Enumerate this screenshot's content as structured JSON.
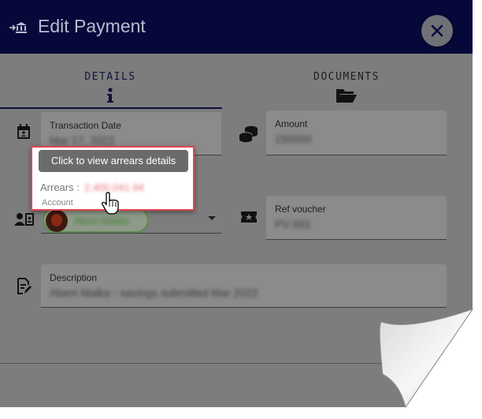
{
  "dialog": {
    "title": "Edit Payment",
    "title_icon": "bank-transfer-icon",
    "close_icon": "close-icon"
  },
  "tabs": [
    {
      "label": "DETAILS",
      "icon": "info-icon",
      "active": true
    },
    {
      "label": "DOCUMENTS",
      "icon": "folder-open-icon",
      "active": false
    }
  ],
  "fields": {
    "transaction_date": {
      "label": "Transaction Date",
      "value": "Mar 17, 2022",
      "icon": "calendar-icon"
    },
    "amount": {
      "label": "Amount",
      "value": "150000",
      "icon": "coins-icon"
    },
    "account": {
      "label": "Account",
      "value": "Aboni Makka",
      "icon": "account-card-icon"
    },
    "ref_voucher": {
      "label": "Ref voucher",
      "value": "PV 001",
      "icon": "ticket-icon"
    },
    "description": {
      "label": "Description",
      "value": "Abeni Malka - savings submitted Mar 2022",
      "icon": "document-edit-icon"
    }
  },
  "popup": {
    "tooltip": "Click to view arrears details",
    "arrears_label": "Arrears :",
    "arrears_value": "2,400,041.94"
  },
  "colors": {
    "topbar": "#06083a",
    "overlay": "#7d7d7d",
    "highlight_border": "#e0454f",
    "arrears_value": "#e8737c",
    "chip_border": "#5e8a4f"
  }
}
